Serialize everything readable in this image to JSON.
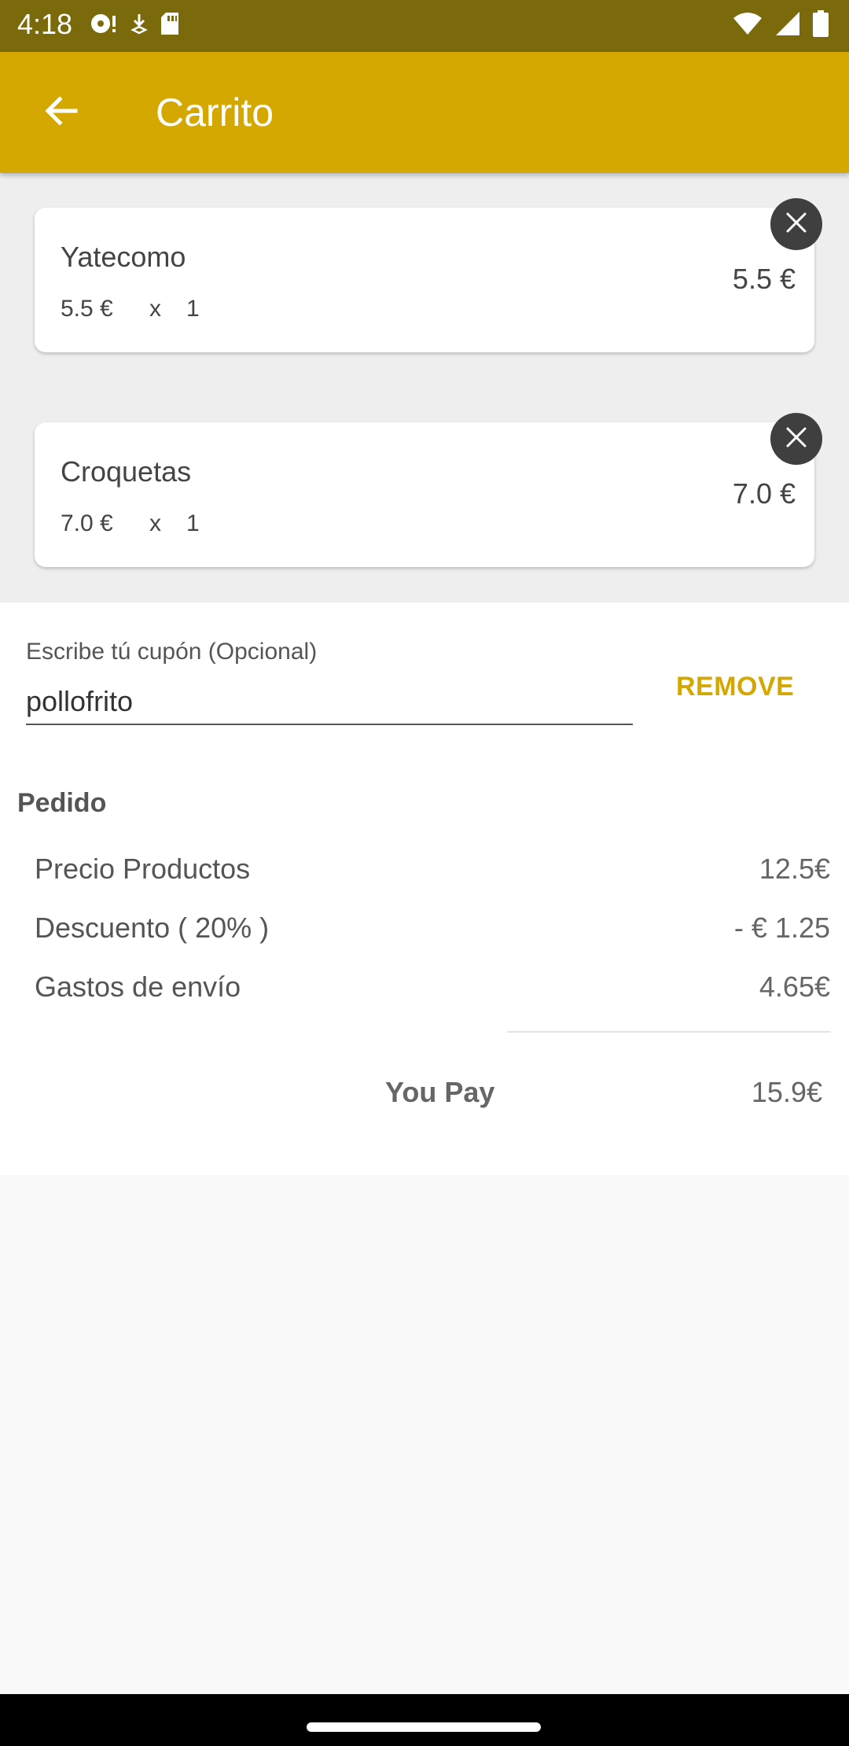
{
  "status_bar": {
    "time": "4:18",
    "left_icons": [
      "record-icon",
      "download-icon",
      "sd-card-icon"
    ],
    "right_icons": [
      "wifi-icon",
      "signal-icon",
      "battery-icon"
    ]
  },
  "app_bar": {
    "title": "Carrito",
    "back_icon": "arrow-left-icon",
    "color": "#d4a800"
  },
  "cart": {
    "items": [
      {
        "name": "Yatecomo",
        "unit_price": "5.5 €",
        "multiply": "x",
        "quantity": "1",
        "total": "5.5 €"
      },
      {
        "name": "Croquetas",
        "unit_price": "7.0 €",
        "multiply": "x",
        "quantity": "1",
        "total": "7.0 €"
      }
    ],
    "remove_icon": "close-icon"
  },
  "coupon": {
    "label": "Escribe tú cupón (Opcional)",
    "value": "pollofrito",
    "remove_label": "REMOVE"
  },
  "order": {
    "title": "Pedido",
    "rows": [
      {
        "label": "Precio Productos",
        "value": "12.5€"
      },
      {
        "label": "Descuento ( 20% )",
        "value": "- € 1.25"
      },
      {
        "label": "Gastos de envío",
        "value": "4.65€"
      }
    ],
    "total_label": "You Pay",
    "total_value": "15.9€"
  },
  "colors": {
    "status_bar": "#7a6a0c",
    "accent": "#d4a800",
    "list_background": "#eeeeee"
  }
}
